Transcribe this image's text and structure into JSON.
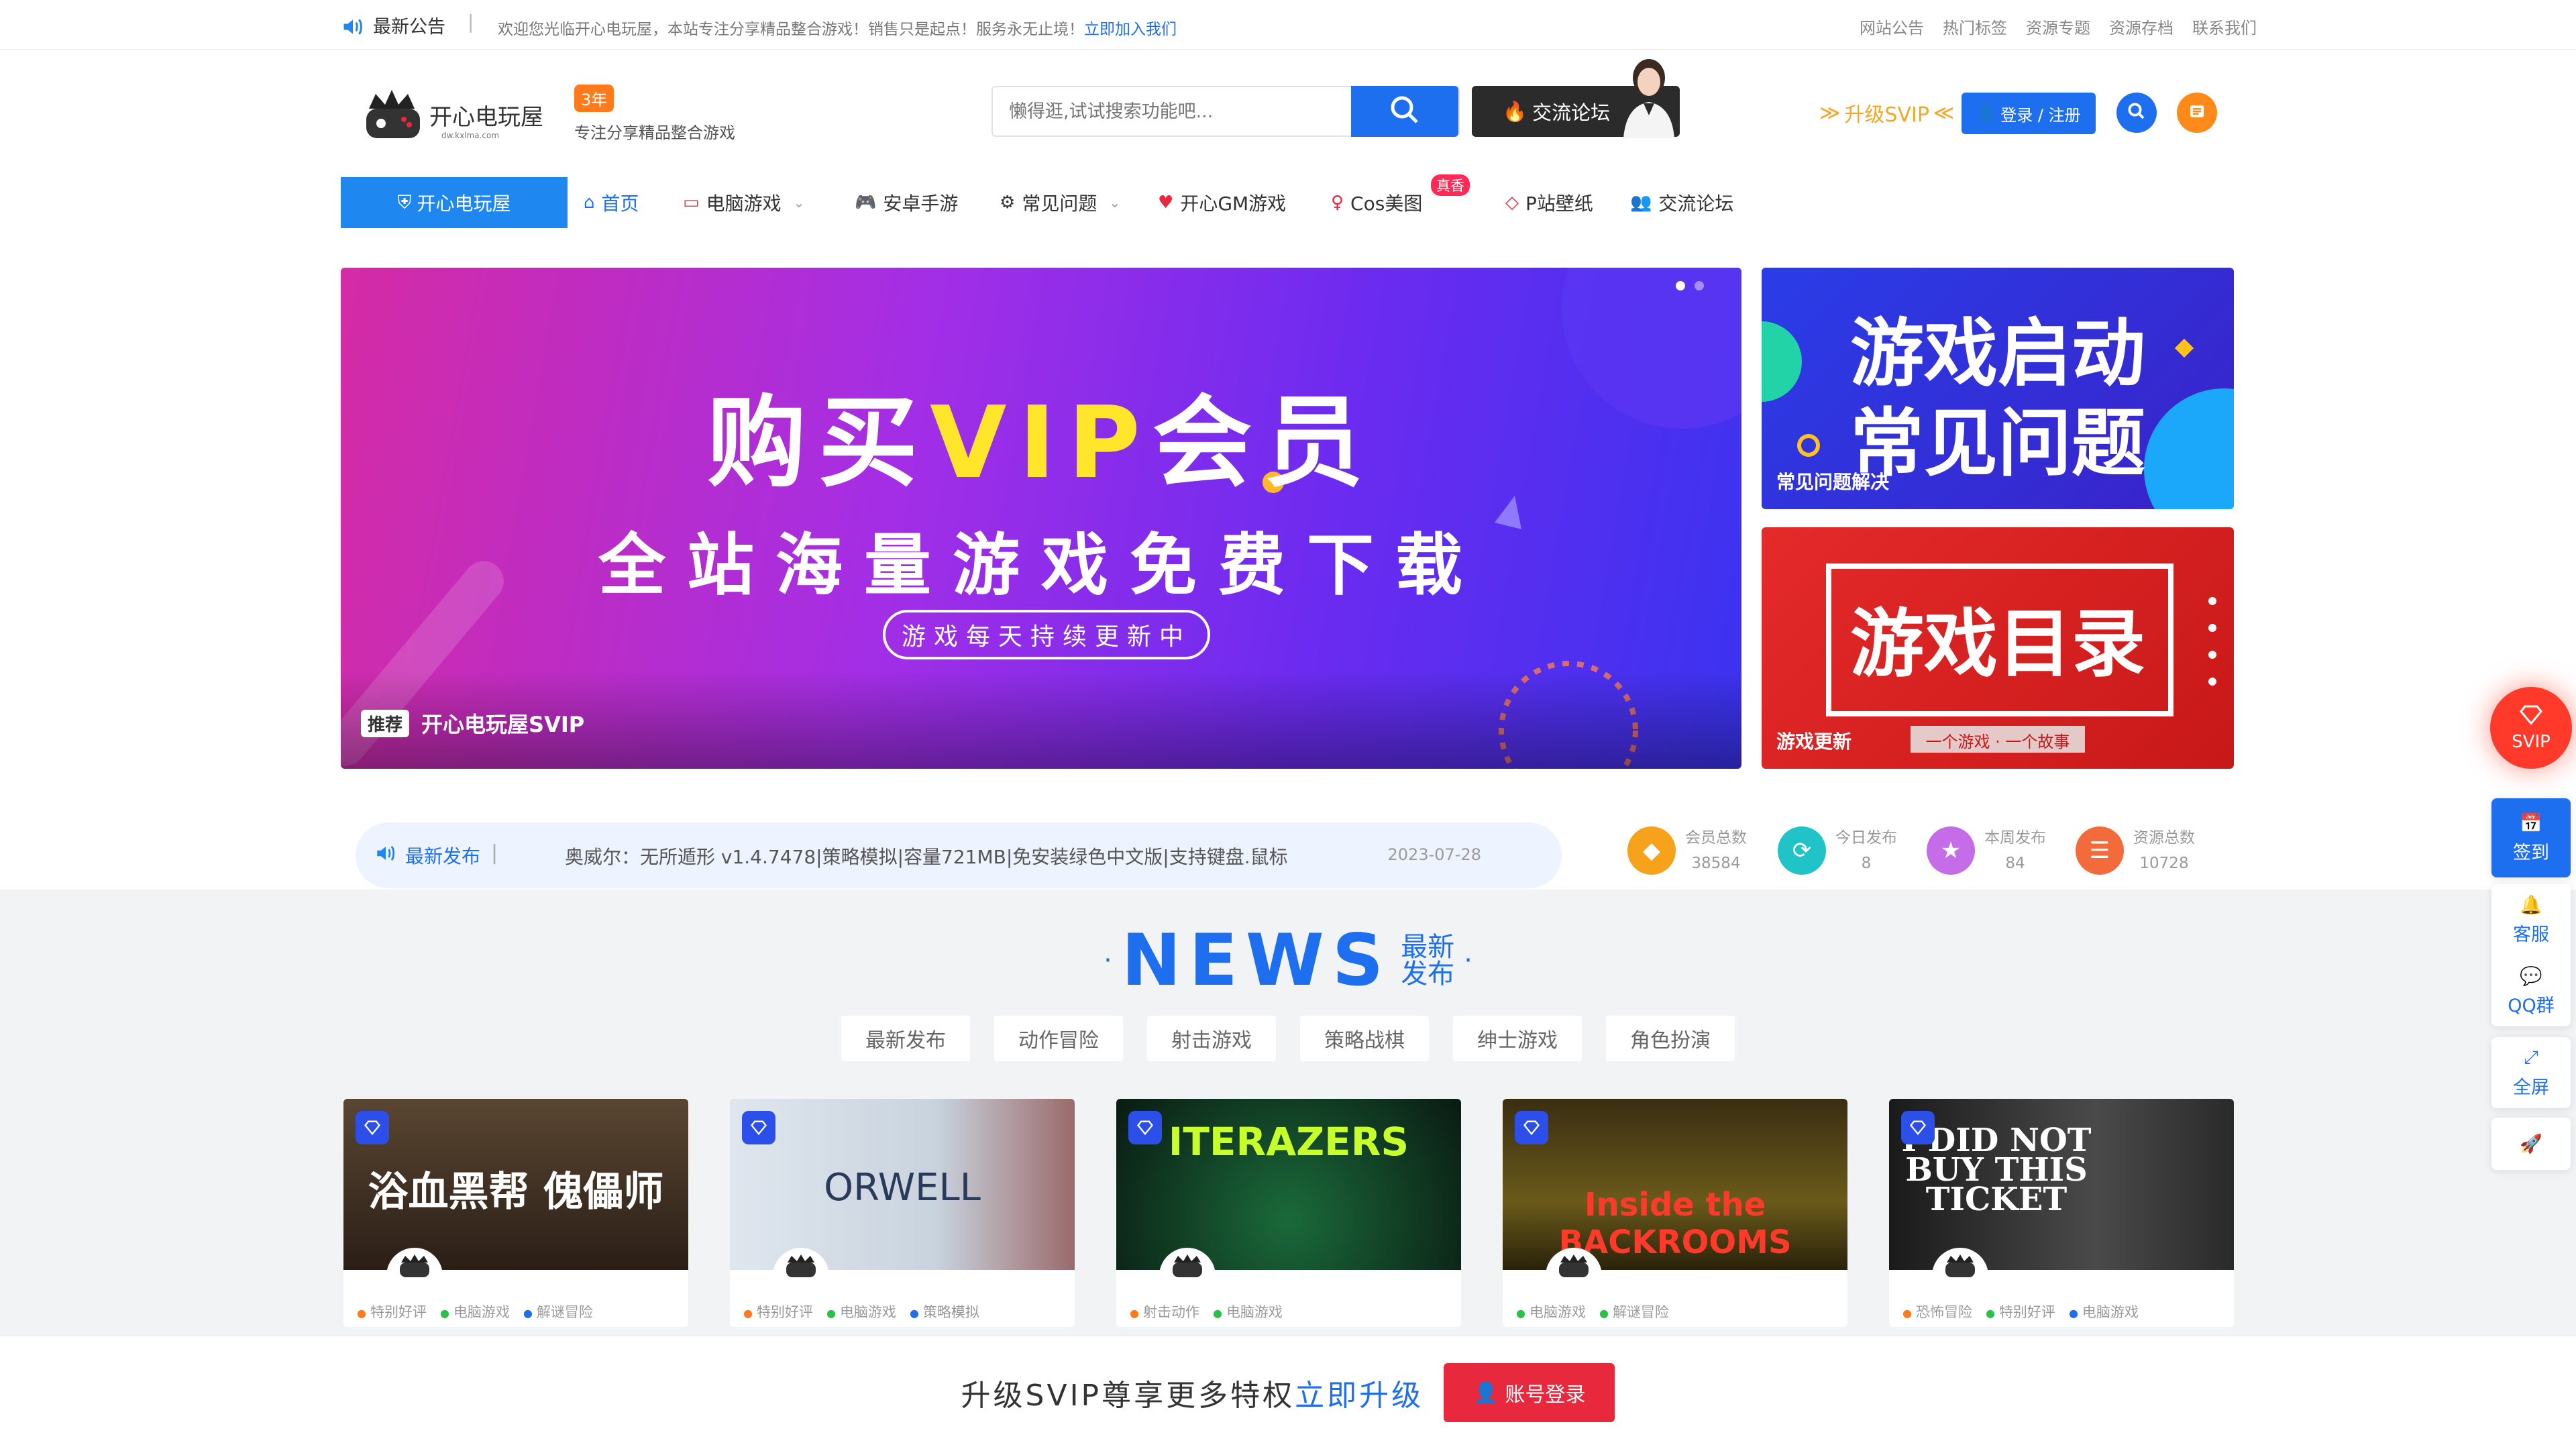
{
  "topbar": {
    "notice_title": "最新公告",
    "separator": "|",
    "welcome_text": "欢迎您光临开心电玩屋，本站专注分享精品整合游戏！销售只是起点！服务永无止境！",
    "join_link": "立即加入我们",
    "links": [
      "网站公告",
      "热门标签",
      "资源专题",
      "资源存档",
      "联系我们"
    ]
  },
  "header": {
    "logo_badge": "3年",
    "slogan": "专注分享精品整合游戏",
    "search_placeholder": "懒得逛,试试搜索功能吧...",
    "forum_button": "交流论坛",
    "svip_link": "升级SVIP",
    "login_button": "登录 / 注册"
  },
  "nav": {
    "brand": "开心电玩屋",
    "items": [
      {
        "label": "首页",
        "icon": "home-icon"
      },
      {
        "label": "电脑游戏",
        "icon": "monitor-icon",
        "dropdown": true
      },
      {
        "label": "安卓手游",
        "icon": "gamepad-icon"
      },
      {
        "label": "常见问题",
        "icon": "gear-icon",
        "dropdown": true
      },
      {
        "label": "开心GM游戏",
        "icon": "heart-icon"
      },
      {
        "label": "Cos美图",
        "icon": "figure-icon",
        "badge": "真香"
      },
      {
        "label": "P站壁纸",
        "icon": "diamond-icon"
      },
      {
        "label": "交流论坛",
        "icon": "users-icon"
      }
    ]
  },
  "banner": {
    "title_pre": "购买",
    "title_vip": "VIP",
    "title_post": "会员",
    "subtitle": "全站海量游戏免费下载",
    "pill": "游戏每天持续更新中",
    "tag": "推荐",
    "caption": "开心电玩屋SVIP"
  },
  "side_cards": [
    {
      "line1": "游戏启动",
      "line2": "常见问题",
      "caption": "常见问题解决"
    },
    {
      "line1": "游戏目录",
      "ribbon": "一个游戏 · 一个故事",
      "caption": "游戏更新"
    }
  ],
  "ticker": {
    "label": "最新发布",
    "separator": "|",
    "text": "奥威尔：无所遁形 v1.4.7478|策略模拟|容量721MB|免安装绿色中文版|支持键盘.鼠标",
    "date": "2023-07-28"
  },
  "stats": [
    {
      "label": "会员总数",
      "value": "38584",
      "color": "#f7a21b"
    },
    {
      "label": "今日发布",
      "value": "8",
      "color": "#20c3c8"
    },
    {
      "label": "本周发布",
      "value": "84",
      "color": "#c56ce8"
    },
    {
      "label": "资源总数",
      "value": "10728",
      "color": "#f36b3a"
    }
  ],
  "news": {
    "big": "NEWS",
    "small_1": "最新",
    "small_2": "发布",
    "filters": [
      "最新发布",
      "动作冒险",
      "射击游戏",
      "策略战棋",
      "绅士游戏",
      "角色扮演"
    ]
  },
  "games": [
    {
      "overlay": "浴血黑帮 傀儡师",
      "tags": [
        "特别好评",
        "电脑游戏",
        "解谜冒险"
      ]
    },
    {
      "overlay": "ORWELL",
      "tags": [
        "特别好评",
        "电脑游戏",
        "策略模拟"
      ]
    },
    {
      "overlay": "ITERAZERS",
      "tags": [
        "射击动作",
        "电脑游戏"
      ]
    },
    {
      "overlay": "Inside the BACKROOMS",
      "tags": [
        "电脑游戏",
        "解谜冒险"
      ]
    },
    {
      "overlay": "I DID NOT BUY THIS TICKET",
      "tags": [
        "恐怖冒险",
        "特别好评",
        "电脑游戏"
      ]
    }
  ],
  "bottom_bar": {
    "text": "升级SVIP尊享更多特权",
    "link": "立即升级",
    "login": "账号登录"
  },
  "float_tools": {
    "svip": "SVIP",
    "sign": "签到",
    "service": "客服",
    "qq": "QQ群",
    "fullscreen": "全屏"
  },
  "colors": {
    "primary": "#1e6ff0",
    "accent_orange": "#ff7a1a",
    "danger": "#e8283c"
  }
}
